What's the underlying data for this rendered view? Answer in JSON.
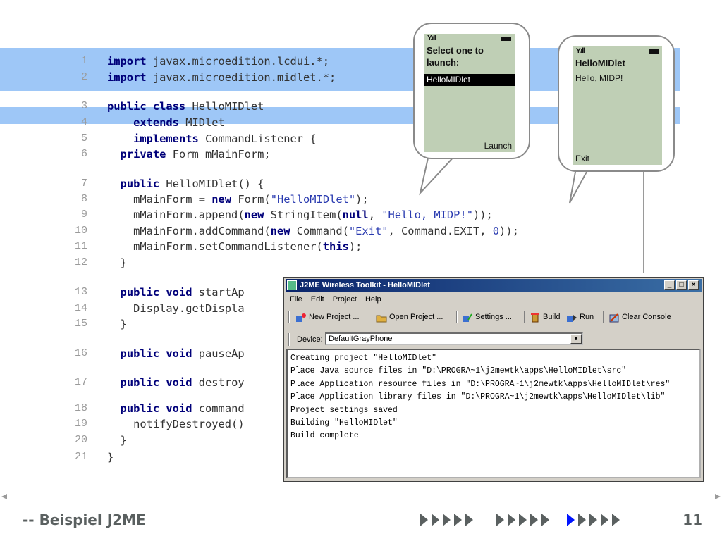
{
  "code": {
    "lines": [
      {
        "n": "1",
        "parts": [
          {
            "t": "import",
            "c": "kw"
          },
          {
            "t": " javax.microedition.lcdui.*;"
          }
        ]
      },
      {
        "n": "2",
        "parts": [
          {
            "t": "import",
            "c": "kw"
          },
          {
            "t": " javax.microedition.midlet.*;"
          }
        ]
      },
      {
        "n": "3",
        "parts": [
          {
            "t": "public class",
            "c": "kw"
          },
          {
            "t": " HelloMIDlet"
          }
        ]
      },
      {
        "n": "4",
        "parts": [
          {
            "t": "    "
          },
          {
            "t": "extends",
            "c": "kw"
          },
          {
            "t": " MIDlet"
          }
        ]
      },
      {
        "n": "5",
        "parts": [
          {
            "t": "    "
          },
          {
            "t": "implements",
            "c": "kw"
          },
          {
            "t": " CommandListener {"
          }
        ]
      },
      {
        "n": "6",
        "parts": [
          {
            "t": "  "
          },
          {
            "t": "private",
            "c": "kw"
          },
          {
            "t": " Form mMainForm;"
          }
        ]
      },
      {
        "n": "7",
        "parts": [
          {
            "t": "  "
          },
          {
            "t": "public",
            "c": "kw"
          },
          {
            "t": " HelloMIDlet() {"
          }
        ]
      },
      {
        "n": "8",
        "parts": [
          {
            "t": "    mMainForm = "
          },
          {
            "t": "new",
            "c": "kw"
          },
          {
            "t": " Form("
          },
          {
            "t": "\"HelloMIDlet\"",
            "c": "str"
          },
          {
            "t": ");"
          }
        ]
      },
      {
        "n": "9",
        "parts": [
          {
            "t": "    mMainForm.append("
          },
          {
            "t": "new",
            "c": "kw"
          },
          {
            "t": " StringItem("
          },
          {
            "t": "null",
            "c": "kw"
          },
          {
            "t": ", "
          },
          {
            "t": "\"Hello, MIDP!\"",
            "c": "str"
          },
          {
            "t": "));"
          }
        ]
      },
      {
        "n": "10",
        "parts": [
          {
            "t": "    mMainForm.addCommand("
          },
          {
            "t": "new",
            "c": "kw"
          },
          {
            "t": " Command("
          },
          {
            "t": "\"Exit\"",
            "c": "str"
          },
          {
            "t": ", Command.EXIT, "
          },
          {
            "t": "0",
            "c": "numlit"
          },
          {
            "t": "));"
          }
        ]
      },
      {
        "n": "11",
        "parts": [
          {
            "t": "    mMainForm.setCommandListener("
          },
          {
            "t": "this",
            "c": "kw"
          },
          {
            "t": ");"
          }
        ]
      },
      {
        "n": "12",
        "parts": [
          {
            "t": "  }"
          }
        ]
      },
      {
        "n": "13",
        "parts": [
          {
            "t": "  "
          },
          {
            "t": "public void",
            "c": "kw"
          },
          {
            "t": " startAp"
          }
        ]
      },
      {
        "n": "14",
        "parts": [
          {
            "t": "    Display.getDispla"
          }
        ]
      },
      {
        "n": "15",
        "parts": [
          {
            "t": "  }"
          }
        ]
      },
      {
        "n": "16",
        "parts": [
          {
            "t": "  "
          },
          {
            "t": "public void",
            "c": "kw"
          },
          {
            "t": " pauseAp"
          }
        ]
      },
      {
        "n": "17",
        "parts": [
          {
            "t": "  "
          },
          {
            "t": "public void",
            "c": "kw"
          },
          {
            "t": " destroy"
          }
        ]
      },
      {
        "n": "18",
        "parts": [
          {
            "t": "  "
          },
          {
            "t": "public void",
            "c": "kw"
          },
          {
            "t": " command"
          }
        ]
      },
      {
        "n": "19",
        "parts": [
          {
            "t": "    notifyDestroyed()"
          }
        ]
      },
      {
        "n": "20",
        "parts": [
          {
            "t": "  }"
          }
        ]
      },
      {
        "n": "21",
        "parts": [
          {
            "t": "}"
          }
        ]
      }
    ]
  },
  "phone_left": {
    "title_line1": "Select one to",
    "title_line2": "launch:",
    "selected_item": "HelloMIDlet",
    "soft_right": "Launch"
  },
  "phone_right": {
    "title": "HelloMIDlet",
    "body": "Hello, MIDP!",
    "soft_left": "Exit"
  },
  "window": {
    "title": "J2ME Wireless Toolkit - HelloMIDlet",
    "menu": [
      "File",
      "Edit",
      "Project",
      "Help"
    ],
    "toolbar": {
      "new_project": "New Project ...",
      "open_project": "Open Project ...",
      "settings": "Settings ...",
      "build": "Build",
      "run": "Run",
      "clear_console": "Clear Console"
    },
    "device_label": "Device:",
    "device_value": "DefaultGrayPhone",
    "console": "Creating project \"HelloMIDlet\"\nPlace Java source files in \"D:\\PROGRA~1\\j2mewtk\\apps\\HelloMIDlet\\src\"\nPlace Application resource files in \"D:\\PROGRA~1\\j2mewtk\\apps\\HelloMIDlet\\res\"\nPlace Application library files in \"D:\\PROGRA~1\\j2mewtk\\apps\\HelloMIDlet\\lib\"\nProject settings saved\nBuilding \"HelloMIDlet\"\nBuild complete"
  },
  "footer": {
    "title": "-- Beispiel J2ME",
    "page": "11",
    "nav_groups": 3,
    "nav_active_group": 3,
    "nav_active_index": 1
  },
  "colors": {
    "highlight": "#9ec7f7",
    "keyword": "#00007a",
    "string": "#2a3bb0",
    "phone_screen": "#bfcfb5",
    "nav_active": "#0014ff"
  }
}
